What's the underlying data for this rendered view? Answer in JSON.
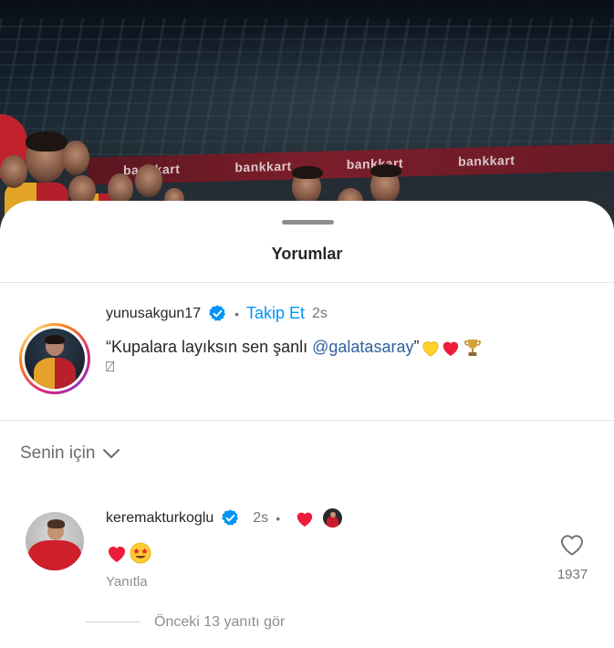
{
  "sheet": {
    "title": "Yorumlar"
  },
  "caption": {
    "username": "yunusakgun17",
    "verified": true,
    "follow_label": "Takip Et",
    "time": "2s",
    "text_before": "“Kupalara layıksın sen şanlı ",
    "mention": "@galatasaray",
    "text_after": "”",
    "emoji_line1": [
      "yellow-heart",
      "red-heart",
      "trophy"
    ],
    "line2_glyph": "⍁"
  },
  "section": {
    "label": "Senin için"
  },
  "comment": {
    "username": "keremakturkoglu",
    "verified": true,
    "time": "2s",
    "creator_liked": true,
    "emojis": [
      "red-heart",
      "star-struck"
    ],
    "reply_label": "Yanıtla",
    "like_count": "1937"
  },
  "more_replies": {
    "label": "Önceki 13 yanıtı gör"
  },
  "colors": {
    "follow_blue": "#0095f6",
    "verified_blue": "#0095f6",
    "heart_red": "#ed1c3a",
    "yellow_heart": "#fdd329",
    "mention_blue": "#2f5f9e"
  }
}
